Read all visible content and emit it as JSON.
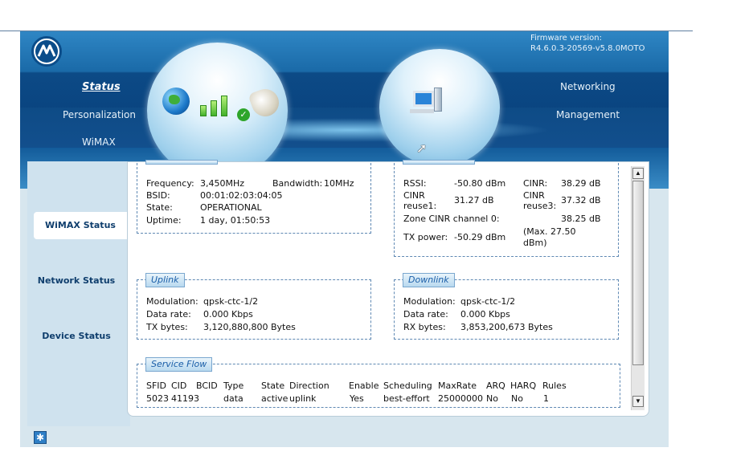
{
  "header": {
    "firmware_label": "Firmware version:",
    "firmware_value": "R4.6.0.3-20569-v5.8.0MOTO",
    "logo": "motorola-logo",
    "nav_left": [
      "Status",
      "Personalization",
      "WiMAX"
    ],
    "nav_right": [
      "Networking",
      "Management"
    ],
    "icons": [
      "globe-icon",
      "signal-bars-icon",
      "check-icon",
      "gear-icon",
      "computer-icon"
    ]
  },
  "side_tabs": [
    "WiMAX Status",
    "Network Status",
    "Device Status"
  ],
  "wimax": {
    "frequency_label": "Frequency:",
    "frequency_value": "3,450MHz",
    "bandwidth_label": "Bandwidth:",
    "bandwidth_value": "10MHz",
    "bsid_label": "BSID:",
    "bsid_value": "00:01:02:03:04:05",
    "state_label": "State:",
    "state_value": "OPERATIONAL",
    "uptime_label": "Uptime:",
    "uptime_value": "1 day, 01:50:53"
  },
  "signal": {
    "rssi_label": "RSSI:",
    "rssi_value": "-50.80 dBm",
    "cinr_label": "CINR:",
    "cinr_value": "38.29 dB",
    "cinr_reuse1_label_1": "CINR",
    "cinr_reuse1_label_2": "reuse1:",
    "cinr_reuse1_value": "31.27 dB",
    "cinr_reuse3_label_1": "CINR",
    "cinr_reuse3_label_2": "reuse3:",
    "cinr_reuse3_value": "37.32 dB",
    "zone_label": "Zone CINR channel 0:",
    "zone_value": "38.25 dB",
    "tx_power_label": "TX power:",
    "tx_power_value": "-50.29 dBm",
    "tx_max_1": "(Max. 27.50",
    "tx_max_2": "dBm)"
  },
  "uplink": {
    "title": "Uplink",
    "modulation_label": "Modulation:",
    "modulation_value": "qpsk-ctc-1/2",
    "rate_label": "Data rate:",
    "rate_value": "0.000 Kbps",
    "bytes_label": "TX bytes:",
    "bytes_value": "3,120,880,800 Bytes"
  },
  "downlink": {
    "title": "Downlink",
    "modulation_label": "Modulation:",
    "modulation_value": "qpsk-ctc-1/2",
    "rate_label": "Data rate:",
    "rate_value": "0.000 Kbps",
    "bytes_label": "RX bytes:",
    "bytes_value": "3,853,200,673 Bytes"
  },
  "service_flow": {
    "title": "Service Flow",
    "columns": [
      "SFID",
      "CID",
      "BCID",
      "Type",
      "State",
      "Direction",
      "Enable",
      "Scheduling",
      "MaxRate",
      "ARQ",
      "HARQ",
      "Rules"
    ],
    "rows": [
      [
        "5023",
        "41193",
        "",
        "data",
        "active",
        "uplink",
        "Yes",
        "best-effort",
        "25000000",
        "No",
        "No",
        "1"
      ]
    ]
  },
  "colors": {
    "header_blue": "#0c4a86",
    "accent_blue": "#1a5ea8",
    "tab_text": "#0f3e6d"
  }
}
